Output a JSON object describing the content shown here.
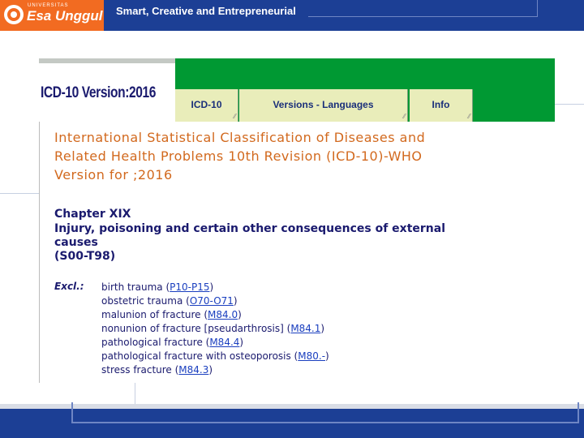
{
  "banner": {
    "logo_small": "UNIVERSITAS",
    "logo_text": "Esa Unggul",
    "tagline": "Smart, Creative and Entrepreneurial"
  },
  "app": {
    "version_title": "ICD-10 Version:2016",
    "tabs": [
      {
        "label": "ICD-10"
      },
      {
        "label": "Versions - Languages"
      },
      {
        "label": "Info"
      }
    ]
  },
  "content": {
    "title_lines": [
      "International Statistical Classification of Diseases and",
      "Related Health Problems 10th Revision (ICD-10)-WHO",
      "Version for ;2016"
    ],
    "chapter_label": "Chapter XIX",
    "chapter_desc_lines": [
      "Injury, poisoning and certain other consequences of external",
      "causes",
      "(S00-T98)"
    ],
    "excl_label": "Excl.:",
    "exclusions": [
      {
        "text": "birth trauma (",
        "code": "P10-P15",
        "suffix": ")"
      },
      {
        "text": "obstetric trauma (",
        "code": "O70-O71",
        "suffix": ")"
      },
      {
        "text": "malunion of fracture (",
        "code": "M84.0",
        "suffix": ")"
      },
      {
        "text": "nonunion of fracture [pseudarthrosis] (",
        "code": "M84.1",
        "suffix": ")"
      },
      {
        "text": "pathological fracture (",
        "code": "M84.4",
        "suffix": ")"
      },
      {
        "text": "pathological fracture with osteoporosis (",
        "code": "M80.-",
        "suffix": ")"
      },
      {
        "text": "stress fracture (",
        "code": "M84.3",
        "suffix": ")"
      }
    ]
  },
  "colors": {
    "banner": "#1c3f95",
    "logo_bg": "#f26b21",
    "app_header": "#009933",
    "tab_bg": "#e9edba",
    "title_text": "#d2691e"
  }
}
